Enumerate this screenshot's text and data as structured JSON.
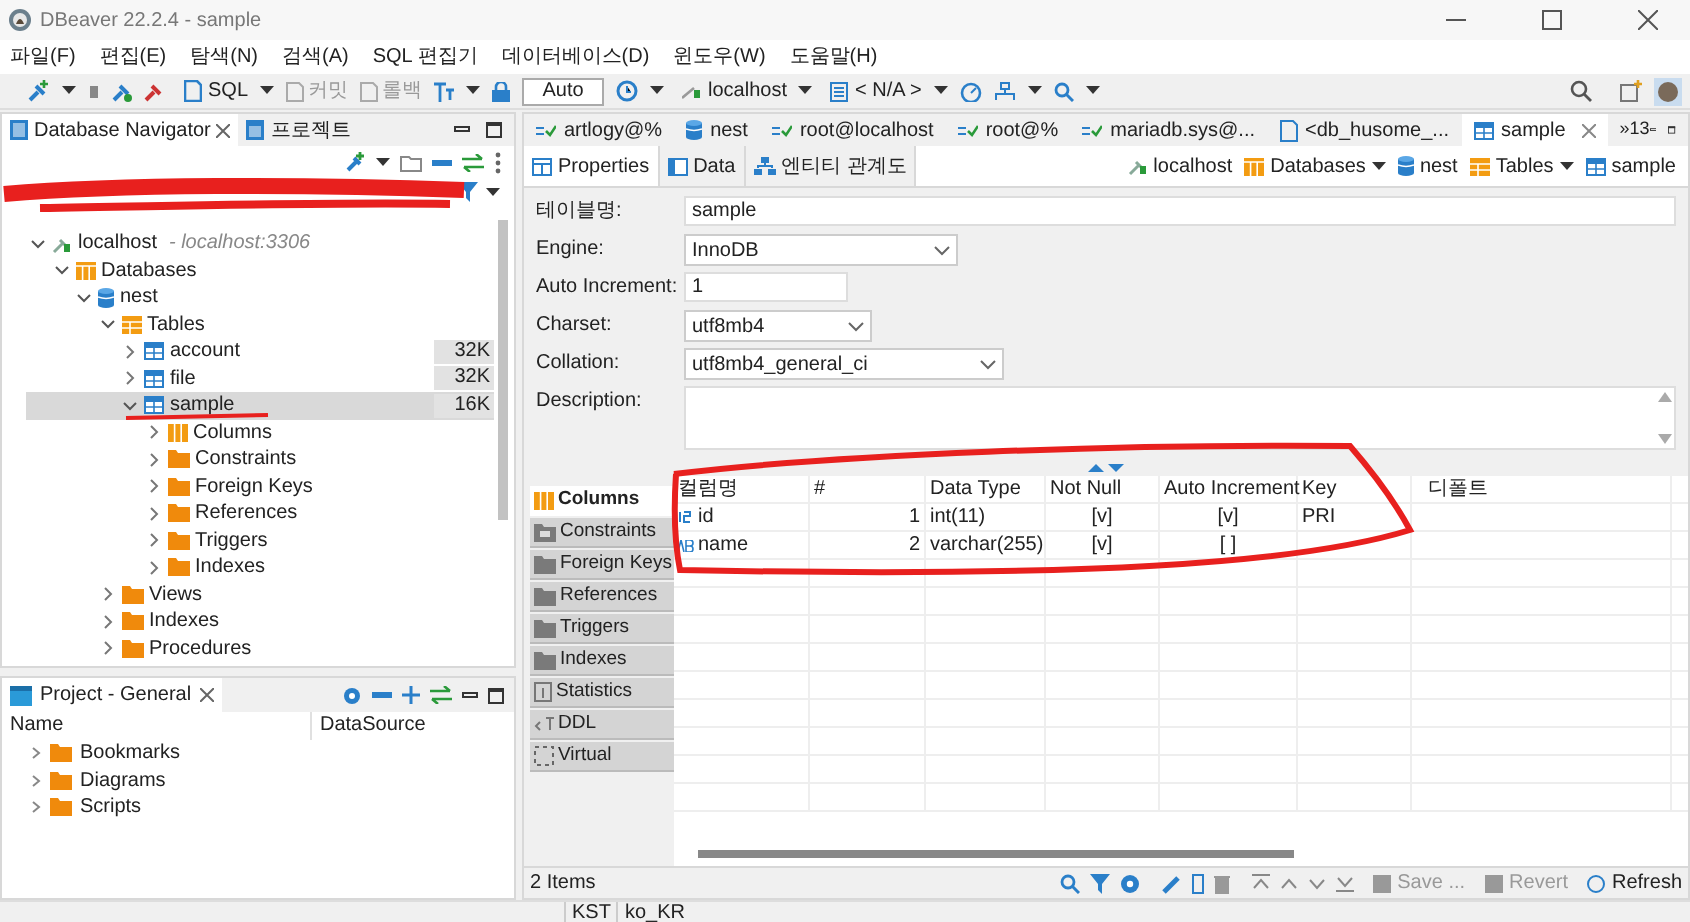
{
  "window": {
    "title": "DBeaver 22.2.4 - sample"
  },
  "menu": [
    "파일(F)",
    "편집(E)",
    "탐색(N)",
    "검색(A)",
    "SQL 편집기",
    "데이터베이스(D)",
    "윈도우(W)",
    "도움말(H)"
  ],
  "toolbar": {
    "sql": "SQL",
    "commit": {
      "label": "커밋",
      "disabled": true
    },
    "rollback": {
      "label": "롤백",
      "disabled": true
    },
    "mode": "Auto",
    "connection": "localhost",
    "schema": "< N/A >"
  },
  "navigator": {
    "tabs": [
      {
        "label": "Database Navigator",
        "selected": true
      },
      {
        "label": "프로젝트",
        "selected": false
      }
    ],
    "tree": [
      {
        "label": "localhost",
        "note": "- localhost:3306",
        "kind": "connection",
        "expanded": true,
        "selected": false,
        "children": [
          {
            "label": "Databases",
            "kind": "databases",
            "expanded": true,
            "selected": false,
            "children": [
              {
                "label": "nest",
                "kind": "database",
                "expanded": true,
                "selected": false,
                "children": [
                  {
                    "label": "Tables",
                    "kind": "tables",
                    "expanded": true,
                    "selected": false,
                    "children": [
                      {
                        "label": "account",
                        "kind": "table",
                        "size": "32K",
                        "expanded": false,
                        "selected": false
                      },
                      {
                        "label": "file",
                        "kind": "table",
                        "size": "32K",
                        "expanded": false,
                        "selected": false
                      },
                      {
                        "label": "sample",
                        "kind": "table",
                        "size": "16K",
                        "expanded": true,
                        "selected": true,
                        "children": [
                          {
                            "label": "Columns",
                            "kind": "columns",
                            "expanded": false,
                            "selected": false
                          },
                          {
                            "label": "Constraints",
                            "kind": "folder",
                            "expanded": false,
                            "selected": false
                          },
                          {
                            "label": "Foreign Keys",
                            "kind": "folder",
                            "expanded": false,
                            "selected": false
                          },
                          {
                            "label": "References",
                            "kind": "folder",
                            "expanded": false,
                            "selected": false
                          },
                          {
                            "label": "Triggers",
                            "kind": "folder",
                            "expanded": false,
                            "selected": false
                          },
                          {
                            "label": "Indexes",
                            "kind": "folder",
                            "expanded": false,
                            "selected": false
                          }
                        ]
                      }
                    ]
                  },
                  {
                    "label": "Views",
                    "kind": "folder",
                    "expanded": false,
                    "selected": false
                  },
                  {
                    "label": "Indexes",
                    "kind": "folder",
                    "expanded": false,
                    "selected": false
                  },
                  {
                    "label": "Procedures",
                    "kind": "folder",
                    "expanded": false,
                    "selected": false
                  }
                ]
              }
            ]
          }
        ]
      }
    ]
  },
  "project": {
    "title": "Project - General",
    "columns": [
      "Name",
      "DataSource"
    ],
    "items": [
      {
        "label": "Bookmarks"
      },
      {
        "label": "Diagrams"
      },
      {
        "label": "Scripts"
      }
    ]
  },
  "editor_tabs": [
    {
      "label": "artlogy@%",
      "kind": "connection",
      "selected": false
    },
    {
      "label": "nest",
      "kind": "database",
      "selected": false
    },
    {
      "label": "root@localhost",
      "kind": "connection",
      "selected": false
    },
    {
      "label": "root@%",
      "kind": "connection",
      "selected": false
    },
    {
      "label": "mariadb.sys@...",
      "kind": "connection",
      "selected": false
    },
    {
      "label": "<db_husome_...",
      "kind": "script",
      "selected": false
    },
    {
      "label": "sample",
      "kind": "table",
      "selected": true
    }
  ],
  "editor_tabs_overflow": "»13",
  "sub_tabs": [
    {
      "label": "Properties",
      "selected": true
    },
    {
      "label": "Data",
      "selected": false
    },
    {
      "label": "엔티티 관계도",
      "selected": false
    }
  ],
  "breadcrumb": [
    {
      "label": "localhost",
      "kind": "connection",
      "dropdown": false
    },
    {
      "label": "Databases",
      "kind": "databases",
      "dropdown": true
    },
    {
      "label": "nest",
      "kind": "database",
      "dropdown": false
    },
    {
      "label": "Tables",
      "kind": "tables",
      "dropdown": true
    },
    {
      "label": "sample",
      "kind": "table",
      "dropdown": false
    }
  ],
  "form": [
    {
      "label": "테이블명:",
      "value": "sample",
      "kind": "text"
    },
    {
      "label": "Engine:",
      "value": "InnoDB",
      "kind": "select"
    },
    {
      "label": "Auto Increment:",
      "value": "1",
      "kind": "short"
    },
    {
      "label": "Charset:",
      "value": "utf8mb4",
      "kind": "select"
    },
    {
      "label": "Collation:",
      "value": "utf8mb4_general_ci",
      "kind": "select"
    },
    {
      "label": "Description:",
      "kind": "textarea"
    }
  ],
  "side_tabs": [
    {
      "label": "Columns",
      "kind": "columns",
      "selected": true
    },
    {
      "label": "Constraints",
      "kind": "constraints",
      "selected": false
    },
    {
      "label": "Foreign Keys",
      "kind": "folder",
      "selected": false
    },
    {
      "label": "References",
      "kind": "folder",
      "selected": false
    },
    {
      "label": "Triggers",
      "kind": "folder",
      "selected": false
    },
    {
      "label": "Indexes",
      "kind": "folder",
      "selected": false
    },
    {
      "label": "Statistics",
      "kind": "statistics",
      "selected": false
    },
    {
      "label": "DDL",
      "kind": "ddl",
      "selected": false
    },
    {
      "label": "Virtual",
      "kind": "virtual",
      "selected": false
    }
  ],
  "table": {
    "columns": [
      "컬럼명",
      "#",
      "Data Type",
      "Not Null",
      "Auto Increment",
      "Key",
      "디폴트"
    ],
    "rows": [
      {
        "kind": "number",
        "cells": [
          "id",
          "1",
          "int(11)",
          "[v]",
          "[v]",
          "PRI"
        ]
      },
      {
        "kind": "text",
        "cells": [
          "name",
          "2",
          "varchar(255)",
          "[v]",
          "[ ]"
        ]
      }
    ]
  },
  "footer": {
    "count": "2 Items",
    "buttons": [
      {
        "label": "Save ...",
        "kind": "save",
        "disabled": true
      },
      {
        "label": "Revert",
        "kind": "revert",
        "disabled": true
      },
      {
        "label": "Refresh",
        "kind": "refresh",
        "disabled": false
      }
    ]
  },
  "status_bar": [
    "KST",
    "ko_KR"
  ],
  "annotations": [
    {
      "kind": "scribble"
    },
    {
      "kind": "underline"
    },
    {
      "kind": "loop"
    }
  ]
}
